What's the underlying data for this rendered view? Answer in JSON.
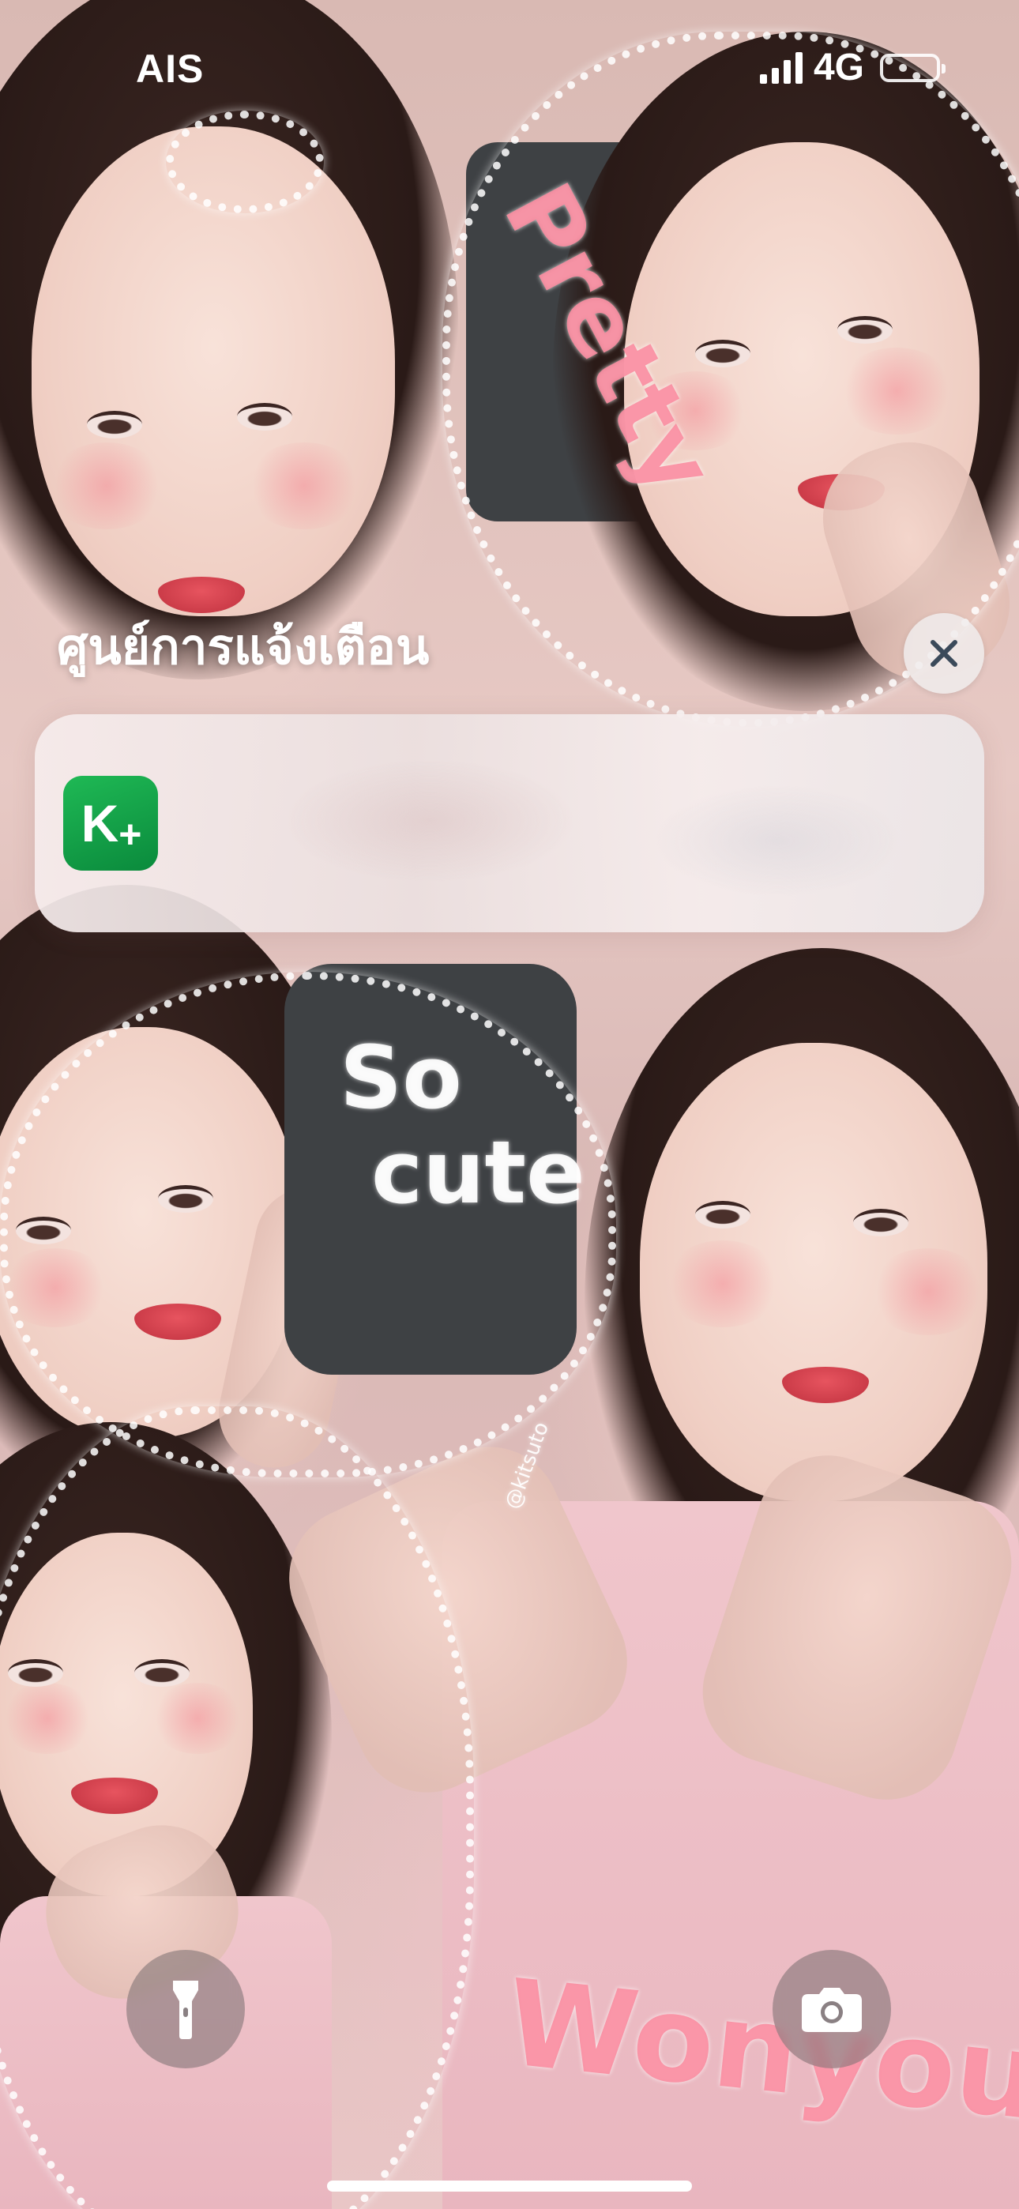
{
  "status_bar": {
    "carrier": "AIS",
    "network": "4G",
    "signal_icon": "cellular-signal-icon",
    "battery_icon": "battery-icon"
  },
  "notification_center": {
    "title": "ศูนย์การแจ้งเตือน",
    "close_icon": "close-icon",
    "notification": {
      "app_name": "K+",
      "app_icon_color": "#12a049"
    }
  },
  "wallpaper": {
    "texts": {
      "pretty": "Pretty",
      "so": "So",
      "cute": "cute",
      "credit": "@kitsuto",
      "wonyoung": "Wonyoung"
    }
  },
  "lock_controls": {
    "flashlight_icon": "flashlight-icon",
    "camera_icon": "camera-icon"
  },
  "colors": {
    "text": "#ffffff",
    "accent_green": "#12a049"
  }
}
